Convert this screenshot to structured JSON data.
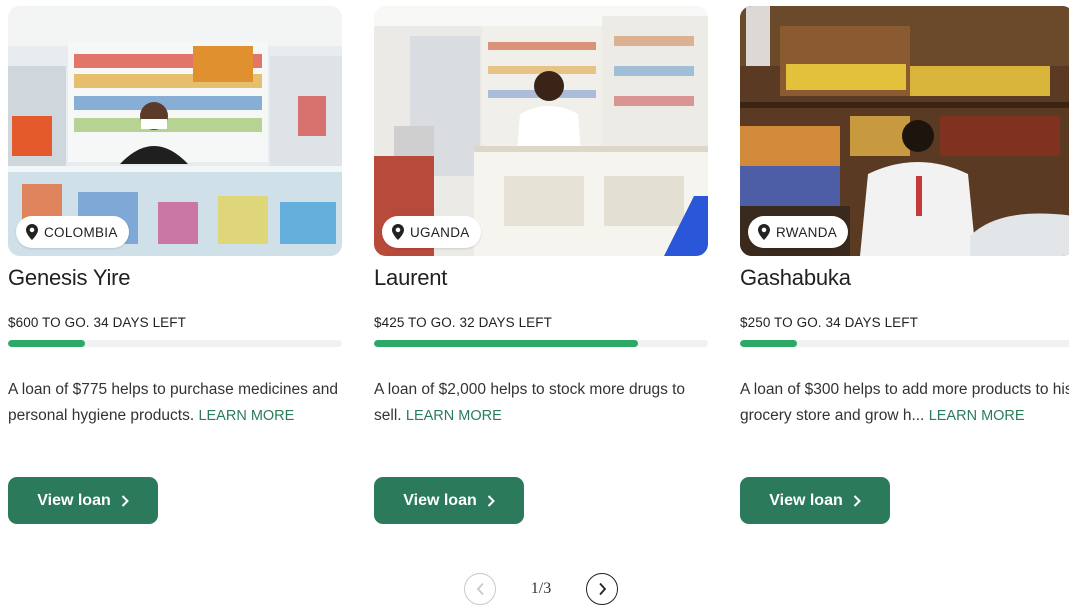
{
  "loans": [
    {
      "country": "COLOMBIA",
      "name": "Genesis Yire",
      "status": "$600 TO GO. 34 DAYS LEFT",
      "progress_fraction": 0.23,
      "description": "A loan of $775 helps to purchase medicines and personal hygiene products.",
      "learn_more": "LEARN MORE",
      "button_label": "View loan"
    },
    {
      "country": "UGANDA",
      "name": "Laurent",
      "status": "$425 TO GO. 32 DAYS LEFT",
      "progress_fraction": 0.79,
      "description": "A loan of $2,000 helps to stock more drugs to sell.",
      "learn_more": "LEARN MORE",
      "button_label": "View loan"
    },
    {
      "country": "RWANDA",
      "name": "Gashabuka",
      "status": "$250 TO GO. 34 DAYS LEFT",
      "progress_fraction": 0.17,
      "description": "A loan of $300 helps to add more products to his grocery store and grow h...",
      "learn_more": "LEARN MORE",
      "button_label": "View loan"
    }
  ],
  "pagination": {
    "label": "1/3"
  },
  "colors": {
    "accent_green": "#2b7a5b",
    "progress_green": "#2aa967",
    "link_green": "#2b7c5a"
  },
  "icons": {
    "location": "map-pin-icon",
    "button_chevron": "chevron-right-icon",
    "pager_prev": "chevron-left-icon",
    "pager_next": "chevron-right-icon"
  }
}
